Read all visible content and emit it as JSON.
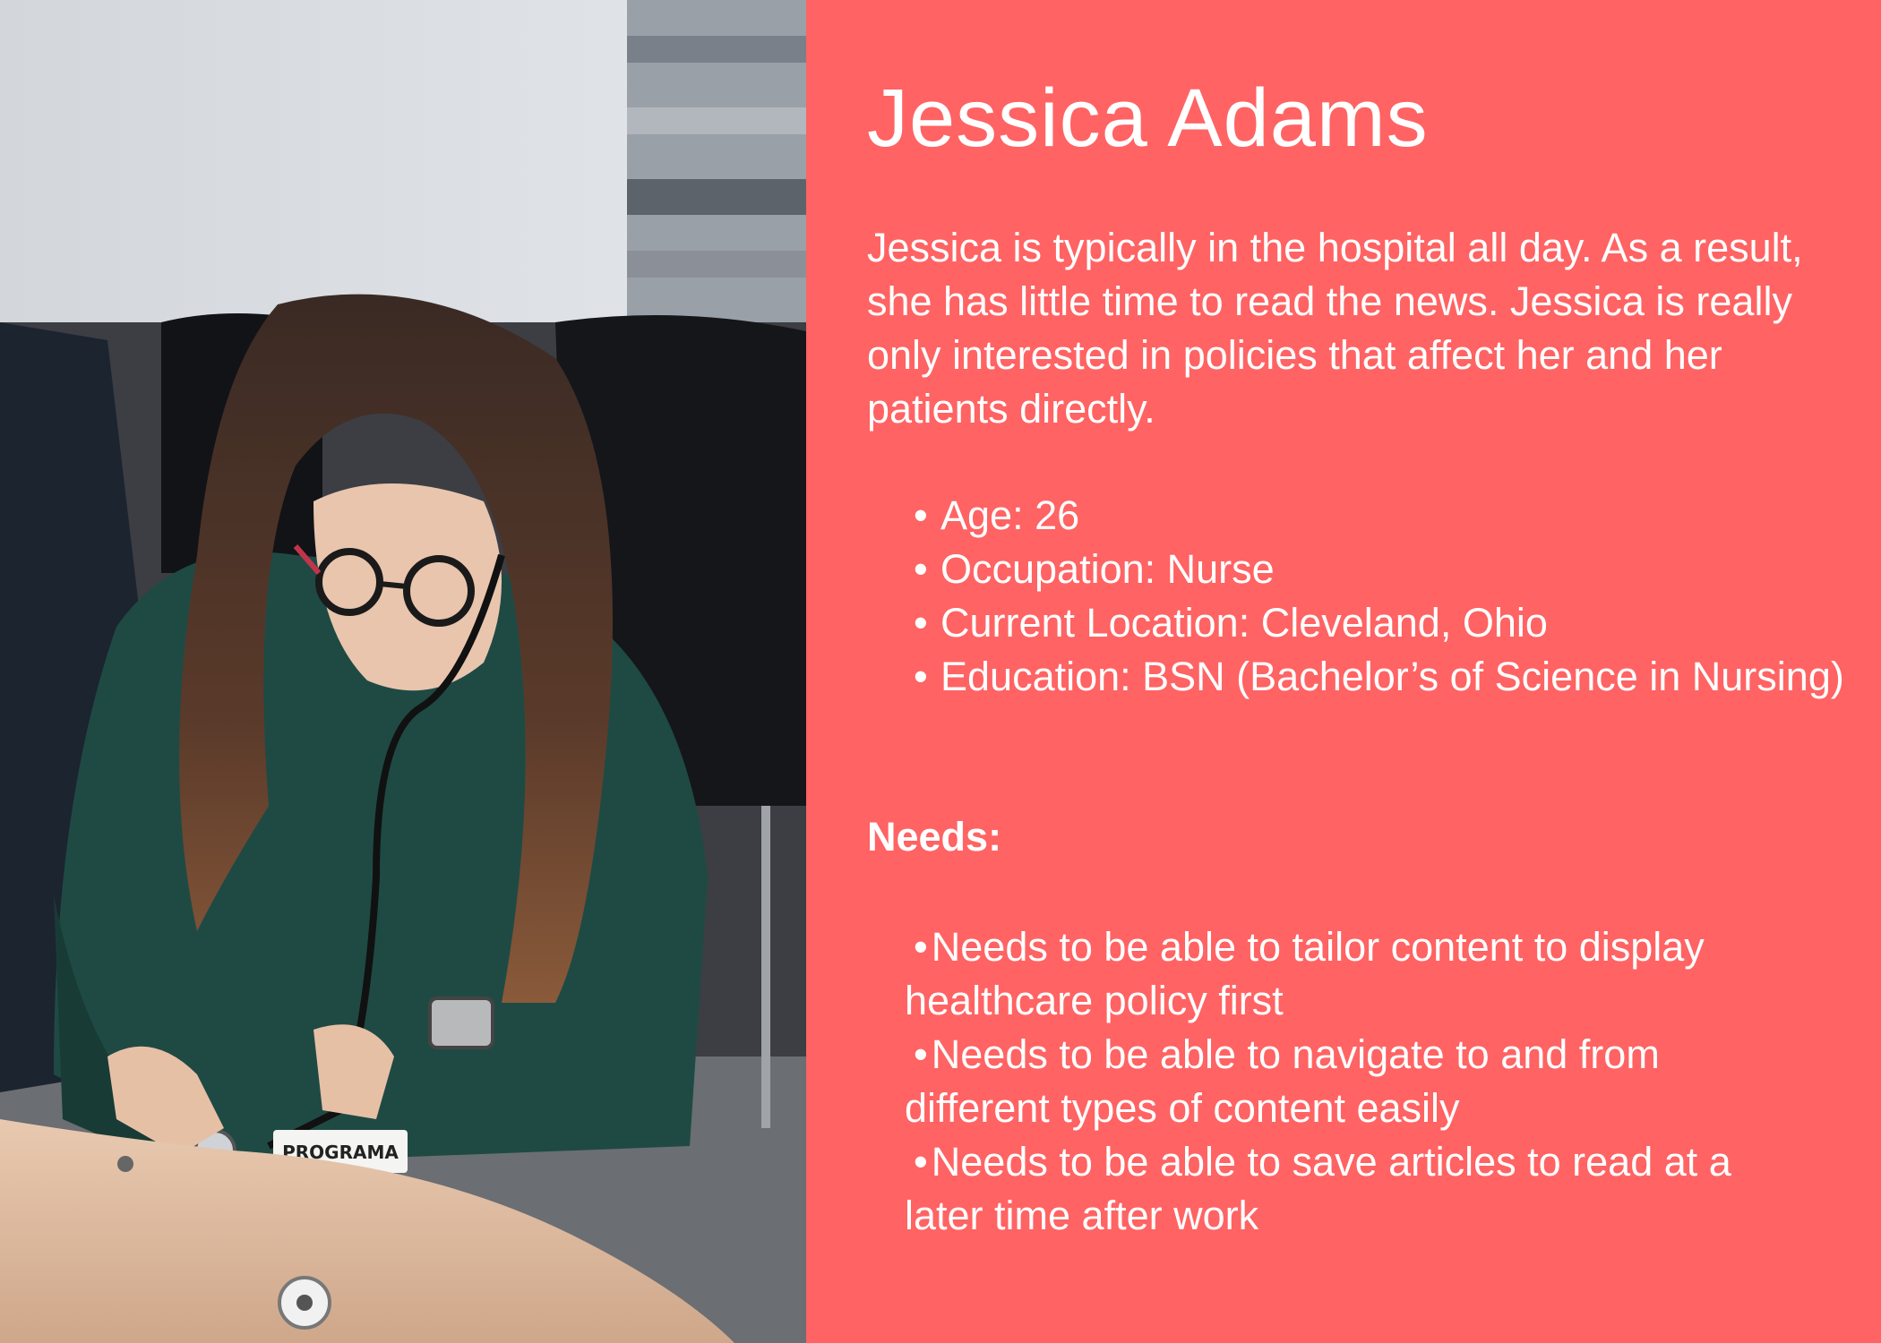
{
  "persona": {
    "name": "Jessica Adams",
    "intro": "Jessica is typically in the hospital all day. As a result, she has little time to read the news. Jessica is really only interested in policies that affect her and her patients directly.",
    "facts": [
      "Age: 26",
      "Occupation: Nurse",
      "Current Location: Cleveland, Ohio",
      "Education: BSN (Bachelor’s of Science in Nursing)"
    ],
    "needs_heading": "Needs:",
    "needs": [
      "Needs to be able to tailor content to display healthcare policy first",
      "Needs to be able to navigate to and from different types of content easily",
      "Needs to be able to save articles to read at a later time after work"
    ]
  },
  "photo": {
    "badge_text": "PROGRAMA"
  },
  "colors": {
    "panel_background": "#ff6363",
    "text": "#ffffff"
  }
}
